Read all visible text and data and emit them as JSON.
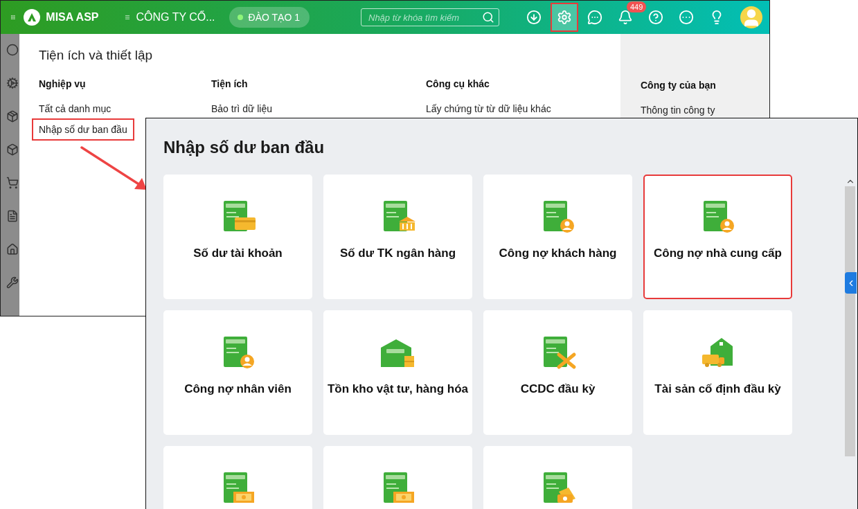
{
  "header": {
    "brand": "MISA ASP",
    "company": "CÔNG TY CỔ...",
    "database": "ĐÀO TẠO 1",
    "search": {
      "placeholder": "Nhập từ khóa tìm kiếm"
    },
    "toolbar": [
      {
        "kind": "download",
        "selected": false,
        "highlighted": false
      },
      {
        "kind": "settings",
        "selected": true,
        "highlighted": true
      },
      {
        "kind": "chat",
        "selected": false,
        "highlighted": false
      },
      {
        "kind": "bell",
        "selected": false,
        "highlighted": false,
        "badge": "449"
      },
      {
        "kind": "help",
        "selected": false,
        "highlighted": false
      },
      {
        "kind": "more",
        "selected": false,
        "highlighted": false
      },
      {
        "kind": "idea",
        "selected": false,
        "highlighted": false
      }
    ]
  },
  "menu": {
    "title": "Tiện ích và thiết lập",
    "columns": [
      {
        "heading": "Nghiệp vụ",
        "items": [
          {
            "label": "Tất cả danh mục",
            "highlighted": false
          },
          {
            "label": "Nhập số dư ban đầu",
            "highlighted": true
          }
        ]
      },
      {
        "heading": "Tiện ích",
        "items": [
          {
            "label": "Bảo trì dữ liệu",
            "highlighted": false
          }
        ]
      },
      {
        "heading": "Công cụ khác",
        "items": [
          {
            "label": "Lấy chứng từ từ dữ liệu khác",
            "highlighted": false
          }
        ]
      },
      {
        "heading": "Công ty của bạn",
        "items": [
          {
            "label": "Thông tin công ty",
            "highlighted": false
          }
        ]
      }
    ]
  },
  "panel": {
    "title": "Nhập số dư ban đầu",
    "cards": [
      {
        "label": "Số dư tài khoản",
        "kind": "card",
        "highlighted": false
      },
      {
        "label": "Số dư TK ngân hàng",
        "kind": "bank",
        "highlighted": false
      },
      {
        "label": "Công nợ khách hàng",
        "kind": "customer",
        "highlighted": false
      },
      {
        "label": "Công nợ nhà cung cấp",
        "kind": "supplier",
        "highlighted": true
      },
      {
        "label": "Công nợ nhân viên",
        "kind": "employee",
        "highlighted": false
      },
      {
        "label": "Tồn kho vật tư, hàng hóa",
        "kind": "warehouse",
        "highlighted": false
      },
      {
        "label": "CCDC đầu kỳ",
        "kind": "tools",
        "highlighted": false
      },
      {
        "label": "Tài sản cố định đầu kỳ",
        "kind": "truck",
        "highlighted": false
      },
      {
        "kind": "transfer",
        "highlighted": false
      },
      {
        "kind": "number",
        "highlighted": false
      },
      {
        "kind": "cash",
        "highlighted": false
      }
    ]
  }
}
